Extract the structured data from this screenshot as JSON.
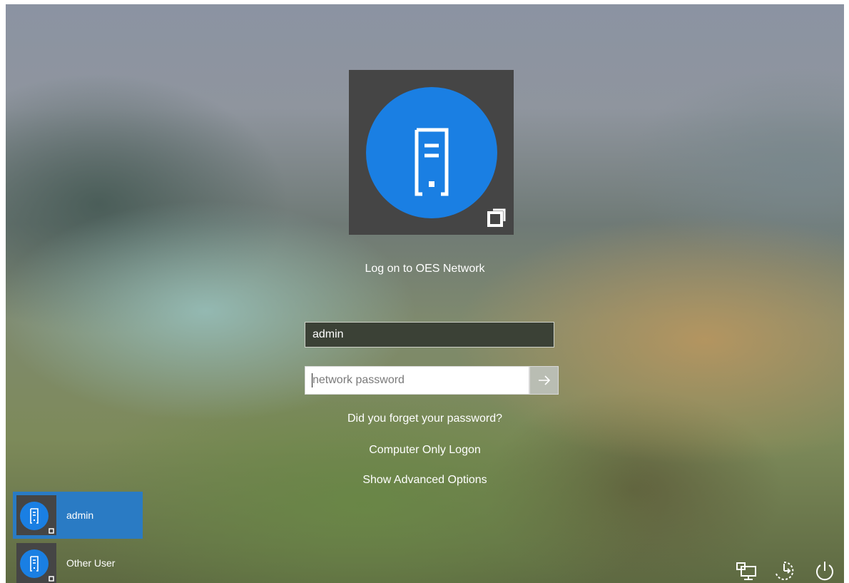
{
  "login": {
    "title": "Log on to OES Network",
    "username_value": "admin",
    "password_placeholder": "network password",
    "submit_icon": "arrow-right-icon"
  },
  "links": {
    "forgot": "Did you forget your password?",
    "computer_only": "Computer Only Logon",
    "advanced": "Show Advanced Options"
  },
  "users": [
    {
      "label": "admin",
      "selected": true,
      "icon": "server-user-icon"
    },
    {
      "label": "Other User",
      "selected": false,
      "icon": "server-user-icon"
    }
  ],
  "system_icons": [
    "network-icon",
    "accessibility-icon",
    "power-icon"
  ],
  "colors": {
    "accent": "#1a7fe3",
    "tile": "#454545",
    "selected_user": "#2a7bc4"
  }
}
